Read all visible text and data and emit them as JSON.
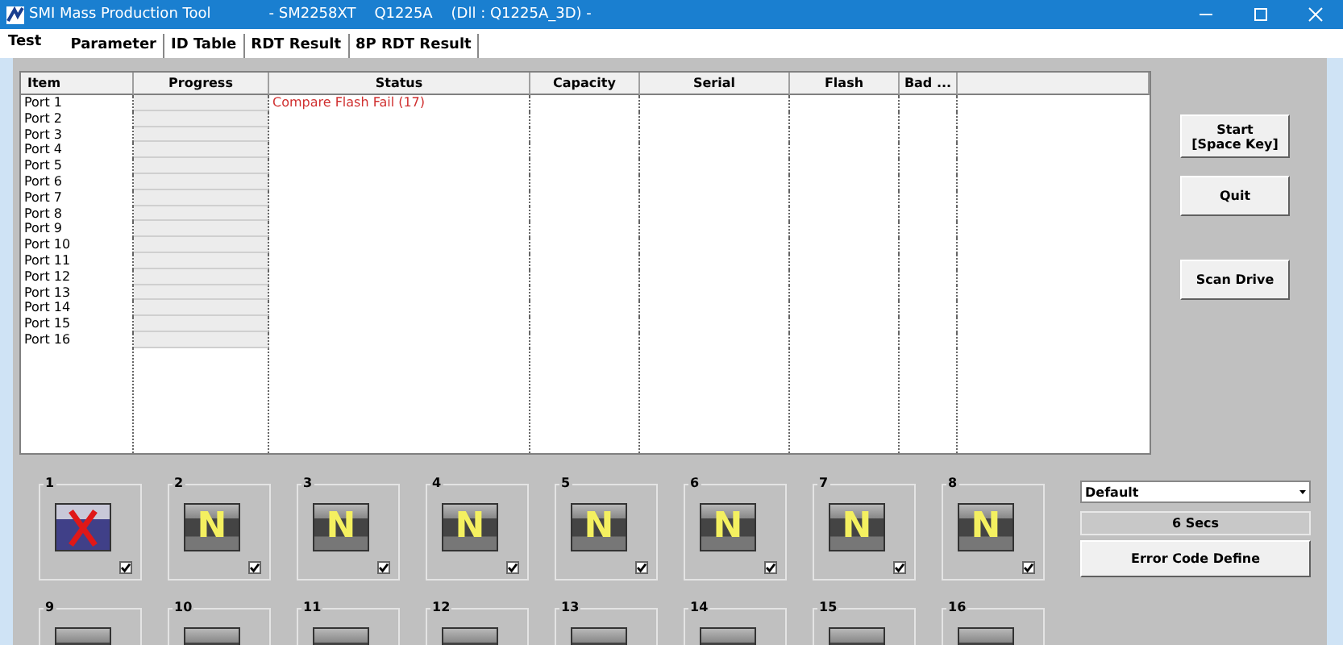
{
  "window": {
    "title": "SMI Mass Production Tool",
    "subtitle": "- SM2258XT    Q1225A    (Dll : Q1225A_3D) -"
  },
  "tabs": [
    {
      "label": "Test",
      "selected": true
    },
    {
      "label": "Parameter",
      "selected": false
    },
    {
      "label": "ID Table",
      "selected": false
    },
    {
      "label": "RDT Result",
      "selected": false
    },
    {
      "label": "8P RDT Result",
      "selected": false
    }
  ],
  "table": {
    "columns": [
      "Item",
      "Progress",
      "Status",
      "Capacity",
      "Serial",
      "Flash",
      "Bad ..."
    ],
    "rows": [
      {
        "item": "Port 1",
        "level": 0,
        "status": {
          "text": "Compare Flash Fail (17)",
          "error": true
        }
      },
      {
        "item": "Port 2",
        "level": 0
      },
      {
        "item": "Port 3",
        "level": 0
      },
      {
        "item": "Port 4",
        "level": 0
      },
      {
        "item": "Port 5",
        "level": 0
      },
      {
        "item": "Port 6",
        "level": 0
      },
      {
        "item": "Port 7",
        "level": 0
      },
      {
        "item": "Port 8",
        "level": 0
      },
      {
        "item": "Port 9",
        "level": 0
      },
      {
        "item": "Port 10",
        "level": 0
      },
      {
        "item": "Port 11",
        "level": 0
      },
      {
        "item": "Port 12",
        "level": 0
      },
      {
        "item": "Port 13",
        "level": 0
      },
      {
        "item": "Port 14",
        "level": 0
      },
      {
        "item": "Port 15",
        "level": 0
      },
      {
        "item": "Port 16",
        "level": 0
      }
    ]
  },
  "buttons": [
    {
      "label": "Start\n[Space Key]"
    },
    {
      "label": "Quit"
    },
    {
      "label": "Scan Drive"
    }
  ],
  "ports": [
    {
      "number": "1",
      "kind": "fail",
      "checked": true
    },
    {
      "number": "2",
      "kind": "idle",
      "badge": "N",
      "checked": true
    },
    {
      "number": "3",
      "kind": "idle",
      "badge": "N",
      "checked": true
    },
    {
      "number": "4",
      "kind": "idle",
      "badge": "N",
      "checked": true
    },
    {
      "number": "5",
      "kind": "idle",
      "badge": "N",
      "checked": true
    },
    {
      "number": "6",
      "kind": "idle",
      "badge": "N",
      "checked": true
    },
    {
      "number": "7",
      "kind": "idle",
      "badge": "N",
      "checked": true
    },
    {
      "number": "8",
      "kind": "idle",
      "badge": "N",
      "checked": true
    },
    {
      "number": "9",
      "kind": "idle"
    },
    {
      "number": "10",
      "kind": "idle"
    },
    {
      "number": "11",
      "kind": "idle"
    },
    {
      "number": "12",
      "kind": "idle"
    },
    {
      "number": "13",
      "kind": "idle"
    },
    {
      "number": "14",
      "kind": "idle"
    },
    {
      "number": "15",
      "kind": "idle"
    },
    {
      "number": "16",
      "kind": "idle"
    }
  ],
  "profile_select": {
    "value": "Default"
  },
  "timer": "6 Secs",
  "error_code_button": "Error Code Define"
}
